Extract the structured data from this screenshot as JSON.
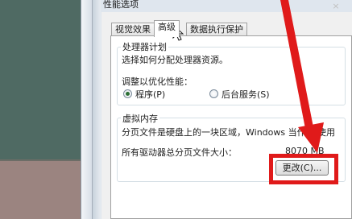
{
  "window": {
    "title": "性能选项",
    "close_glyph": "×"
  },
  "tabs": [
    {
      "label": "视觉效果",
      "active": false
    },
    {
      "label": "高级",
      "active": true
    },
    {
      "label": "数据执行保护",
      "active": false
    }
  ],
  "processor": {
    "legend": "处理器计划",
    "description": "选择如何分配处理器资源。",
    "adjust_label": "调整以优化性能：",
    "option_programs": "程序(P)",
    "option_services": "后台服务(S)",
    "selected": "程序(P)"
  },
  "virtual_memory": {
    "legend": "虚拟内存",
    "description": "分页文件是硬盘上的一块区域，Windows 当作 RA",
    "description_tail": "使用",
    "total_label": "所有驱动器总分页文件大小：",
    "total_value": "8070 MB",
    "change_button": "更改(C)..."
  },
  "annotation": {
    "color": "#e01a1a"
  },
  "icons": {
    "cursor": "mouse-pointer-icon",
    "arrow": "red-arrow-icon"
  }
}
